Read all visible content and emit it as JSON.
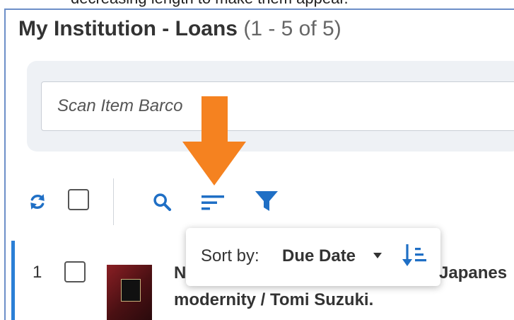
{
  "caption": {
    "text": "decreasing length to make them appear."
  },
  "header": {
    "title": "My Institution - Loans",
    "count": "(1 - 5 of 5)"
  },
  "scan": {
    "placeholder": "Scan Item Barco"
  },
  "icons": {
    "refresh": "refresh-icon",
    "search": "search-icon",
    "sort": "sort-lines-icon",
    "filter": "filter-funnel-icon",
    "sort_order": "sort-ascending-icon",
    "arrow": "down-arrow-annotation"
  },
  "colors": {
    "accent": "#2b7fd6",
    "arrow": "#f58220",
    "icon": "#1f6fc5",
    "frame": "#6d8fc8"
  },
  "sort_popover": {
    "label": "Sort by:",
    "value": "Due Date"
  },
  "rows": [
    {
      "index": "1",
      "title_start": "N",
      "title_end": "Japanes",
      "title_line2": "modernity / Tomi Suzuki."
    }
  ]
}
